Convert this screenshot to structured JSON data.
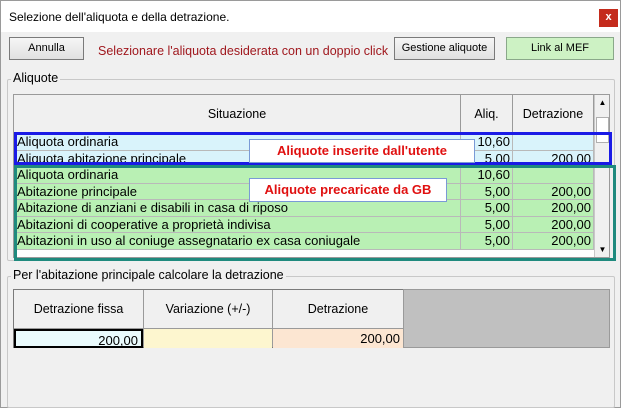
{
  "window": {
    "title": "Selezione dell'aliquota e della detrazione.",
    "close_label": "x"
  },
  "toolbar": {
    "annulla_label": "Annulla",
    "instruction": "Selezionare l'aliquota desiderata con un doppio click",
    "gestione_label": "Gestione aliquote",
    "link_mef_label": "Link al MEF"
  },
  "aliquote": {
    "group_label": "Aliquote",
    "columns": [
      "Situazione",
      "Aliq.",
      "Detrazione"
    ],
    "user_rows": [
      {
        "situazione": "Aliquota ordinaria",
        "aliq": "10,60",
        "detrazione": ""
      },
      {
        "situazione": "Aliquota abitazione principale",
        "aliq": "5,00",
        "detrazione": "200,00"
      }
    ],
    "preloaded_rows": [
      {
        "situazione": "Aliquota ordinaria",
        "aliq": "10,60",
        "detrazione": ""
      },
      {
        "situazione": "Abitazione principale",
        "aliq": "5,00",
        "detrazione": "200,00"
      },
      {
        "situazione": "Abitazione di anziani e disabili in casa di riposo",
        "aliq": "5,00",
        "detrazione": "200,00"
      },
      {
        "situazione": "Abitazioni di cooperative a proprietà indivisa",
        "aliq": "5,00",
        "detrazione": "200,00"
      },
      {
        "situazione": "Abitazioni in uso al coniuge assegnatario ex casa coniugale",
        "aliq": "5,00",
        "detrazione": "200,00"
      }
    ],
    "callout_user": "Aliquote inserite dall'utente",
    "callout_preloaded": "Aliquote precaricate da GB",
    "colors": {
      "user_row_bg": "#d9f3fb",
      "preloaded_row_bg": "#b9f0b4",
      "user_box": "#1a1ae6",
      "preloaded_box": "#1f8a7e"
    }
  },
  "detrazione": {
    "group_label": "Per l'abitazione principale calcolare la detrazione",
    "columns": [
      {
        "label": "Detrazione fissa",
        "value": "200,00",
        "bg": "#eafbfd"
      },
      {
        "label": "Variazione (+/-)",
        "value": "",
        "bg": "#fdf6cf"
      },
      {
        "label": "Detrazione",
        "value": "200,00",
        "bg": "#fce6d2"
      }
    ]
  },
  "scrollbar": {
    "up_icon": "▲",
    "down_icon": "▼"
  }
}
